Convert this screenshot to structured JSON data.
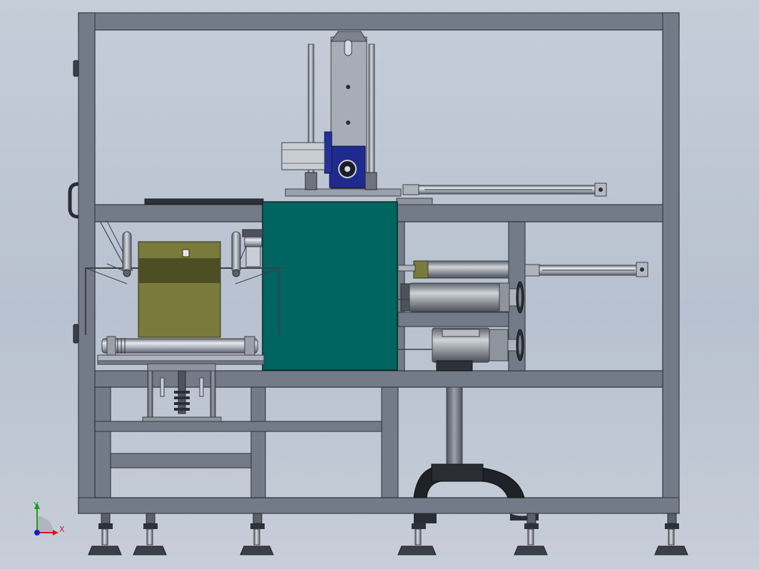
{
  "viewport": {
    "background_top": "#c5cdd9",
    "background_bottom": "#c7ced9"
  },
  "colors": {
    "frame": "#6f7784",
    "frame_edge": "#3d434c",
    "steel_light": "#c9ced6",
    "steel_mid": "#9aa1ab",
    "steel_dark": "#4e545d",
    "teal_panel": "#00625f",
    "olive_box": "#7a7a3c",
    "olive_dark": "#4e4e24",
    "gearbox_blue": "#1f2a8f",
    "black": "#1a1a1a"
  },
  "triad": {
    "x_label": "X",
    "y_label": "Y",
    "x_color": "#d11a1a",
    "y_color": "#19a319",
    "z_color": "#1a1ad1"
  }
}
